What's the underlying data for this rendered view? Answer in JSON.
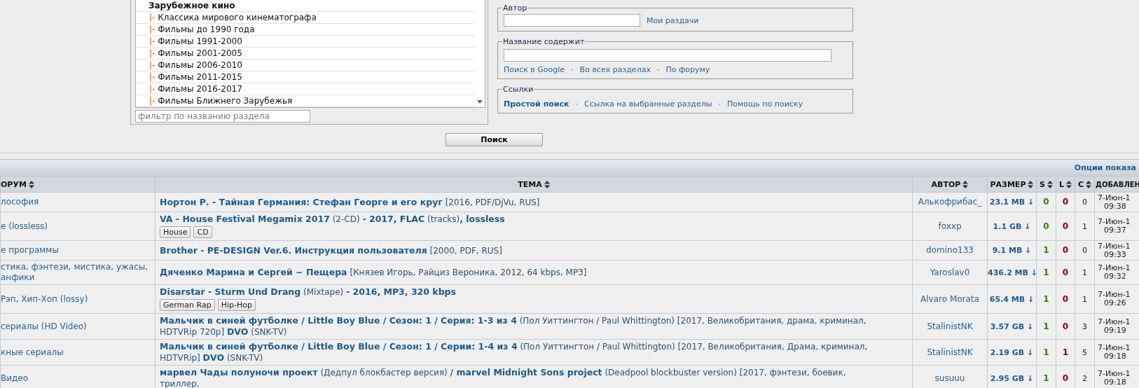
{
  "filter_panel": {
    "categories": [
      {
        "kind": "group",
        "label": "Зарубежное кино"
      },
      {
        "kind": "item",
        "branch": "|-",
        "label": "Классика мирового кинематографа"
      },
      {
        "kind": "item",
        "branch": "|-",
        "label": "Фильмы до 1990 года"
      },
      {
        "kind": "item",
        "branch": "|-",
        "label": "Фильмы 1991-2000"
      },
      {
        "kind": "item",
        "branch": "|-",
        "label": "Фильмы 2001-2005"
      },
      {
        "kind": "item",
        "branch": "|-",
        "label": "Фильмы 2006-2010"
      },
      {
        "kind": "item",
        "branch": "|-",
        "label": "Фильмы 2011-2015"
      },
      {
        "kind": "item",
        "branch": "|-",
        "label": "Фильмы 2016-2017"
      },
      {
        "kind": "item",
        "branch": "|-",
        "label": "Фильмы Ближнего Зарубежья"
      }
    ],
    "filter": {
      "placeholder": "фильтр по названию раздела"
    }
  },
  "search_form": {
    "separator": "·",
    "author": {
      "legend": "Автор",
      "link": "Мои раздачи"
    },
    "title": {
      "legend": "Название содержит",
      "links": [
        "Поиск в Google",
        "Во всех разделах",
        "По форуму"
      ]
    },
    "links": {
      "legend": "Ссылки",
      "items": [
        {
          "label": "Простой поиск",
          "selected": true
        },
        {
          "label": "Ссылка на выбранные разделы",
          "selected": false
        },
        {
          "label": "Помощь по поиску",
          "selected": false
        }
      ]
    }
  },
  "search_button": "Поиск",
  "results": {
    "options_link": "Опции показа",
    "columns": [
      {
        "label": "ОРУМ",
        "sortable": true
      },
      {
        "label": "ТЕМА",
        "sortable": true
      },
      {
        "label": "АВТОР",
        "sortable": true
      },
      {
        "label": "РАЗМЕР",
        "sortable": true
      },
      {
        "label": "S",
        "sortable": true
      },
      {
        "label": "L",
        "sortable": true
      },
      {
        "label": "C",
        "sortable": true
      },
      {
        "label": "ДОБАВЛЕН"
      }
    ],
    "rows": [
      {
        "forum": "лософия",
        "topic": "**Нортон Р. - Тайная Германия: Стефан Георге и его круг** [2016, PDF/DjVu, RUS]",
        "tags": [],
        "author": "Алькофрибас_",
        "size": "23.1 MB ↓",
        "seeds": "0",
        "leechers": "0",
        "comments": "0",
        "date": "7-Июн-1",
        "time": "09:38"
      },
      {
        "forum": "e (lossless)",
        "topic": "**VA - House Festival Megamix 2017** (2-CD) **- 2017, FLAC** (tracks)**, lossless**",
        "tags": [
          "House",
          "CD"
        ],
        "author": "foxxp",
        "size": "1.1 GB ↓",
        "seeds": "0",
        "leechers": "0",
        "comments": "1",
        "date": "7-Июн-1",
        "time": "09:37"
      },
      {
        "forum": "е программы",
        "topic": "**Brother - PE-DESIGN Ver.6. Инструкция пользователя** [2000, PDF, RUS]",
        "tags": [],
        "author": "domino133",
        "size": "9.1 MB ↓",
        "seeds": "1",
        "leechers": "0",
        "comments": "0",
        "date": "7-Июн-1",
        "time": "09:33"
      },
      {
        "forum": "стика, фэнтези, мистика, ужасы,\nанфики",
        "topic": "**Дяченко Марина и Сергей − Пещера** [Князев Игорь, Райциз Вероника, 2012, 64 kbps, MP3]",
        "tags": [],
        "author": "Yaroslav0",
        "size": "436.2 MB ↓",
        "seeds": "1",
        "leechers": "0",
        "comments": "1",
        "date": "7-Июн-1",
        "time": "09:32"
      },
      {
        "forum": "Рэп, Хип-Хоп (lossy)",
        "topic": "**Disarstar - Sturm Und Drang** (Mixtape) **- 2016, MP3, 320 kbps**",
        "tags": [
          "German Rap",
          "Hip-Hop"
        ],
        "author": "Alvaro Morata",
        "size": "65.4 MB ↓",
        "seeds": "1",
        "leechers": "0",
        "comments": "1",
        "date": "7-Июн-1",
        "time": "09:26"
      },
      {
        "forum": "сериалы (HD Video)",
        "topic": "**Мальчик в синей футболке / Little Boy Blue / Сезон: 1 / Серия: 1-3 из 4** (Пол Уиттингтон / Paul Whittington) [2017, Великобритания, драма, криминал, HDTVRip 720p] **DVO** (SNK-TV)",
        "tags": [],
        "author": "StalinistNK",
        "size": "3.57 GB ↓",
        "seeds": "1",
        "leechers": "0",
        "comments": "3",
        "date": "7-Июн-1",
        "time": "09:19"
      },
      {
        "forum": "кные сериалы",
        "topic": "**Мальчик в синей футболке / Little Boy Blue / Сезон: 1 / Серии: 1-4 из 4** (Пол Уиттингтон / Paul Whittington) [2017, Великобритания, Драма, криминал, HDTVRip] **DVO** (SNK-TV)",
        "tags": [],
        "author": "StalinistNK",
        "size": "2.19 GB ↓",
        "seeds": "1",
        "leechers": "1",
        "comments": "5",
        "date": "7-Июн-1",
        "time": "09:18"
      },
      {
        "forum": "Видео",
        "topic": "**марвел Чады полуночи проект** (Дедпул блокбастер версия) **/ marvel Midnight Sons project** (Deadpool blockbuster version) [2017, фэнтези, боевик, триллер,",
        "tags": [],
        "author": "susuuu",
        "size": "2.95 GB ↓",
        "seeds": "1",
        "leechers": "0",
        "comments": "2",
        "date": "7-Июн-1",
        "time": "09:18"
      }
    ]
  }
}
